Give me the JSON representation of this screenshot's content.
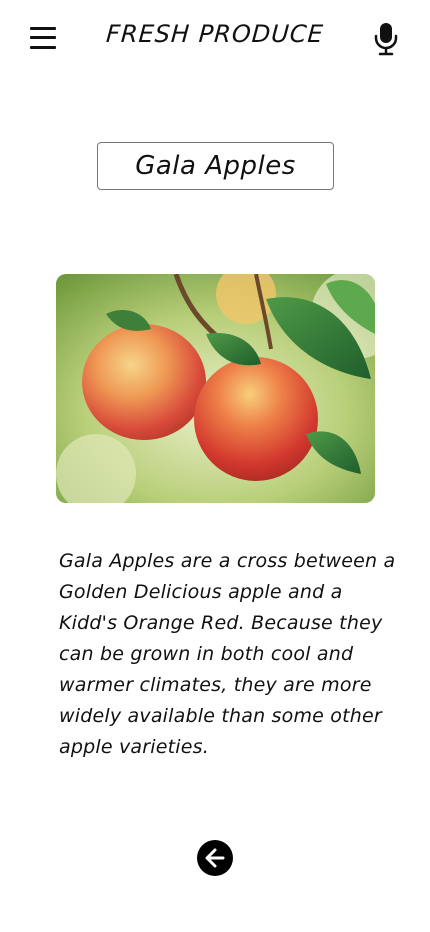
{
  "header": {
    "title": "FRESH PRODUCE",
    "menu_icon": "hamburger-menu-icon",
    "mic_icon": "microphone-icon"
  },
  "product": {
    "name": "Gala Apples",
    "image_description": "apples-on-branch-photo",
    "description": "Gala Apples are a cross between a Golden Delicious apple and a Kidd's Orange Red. Because they can be grown in both cool and warmer climates, they are more widely available than some other apple varieties."
  },
  "footer": {
    "back_icon": "arrow-left-icon"
  },
  "colors": {
    "background": "#ffffff",
    "text": "#111111",
    "button": "#000000"
  }
}
